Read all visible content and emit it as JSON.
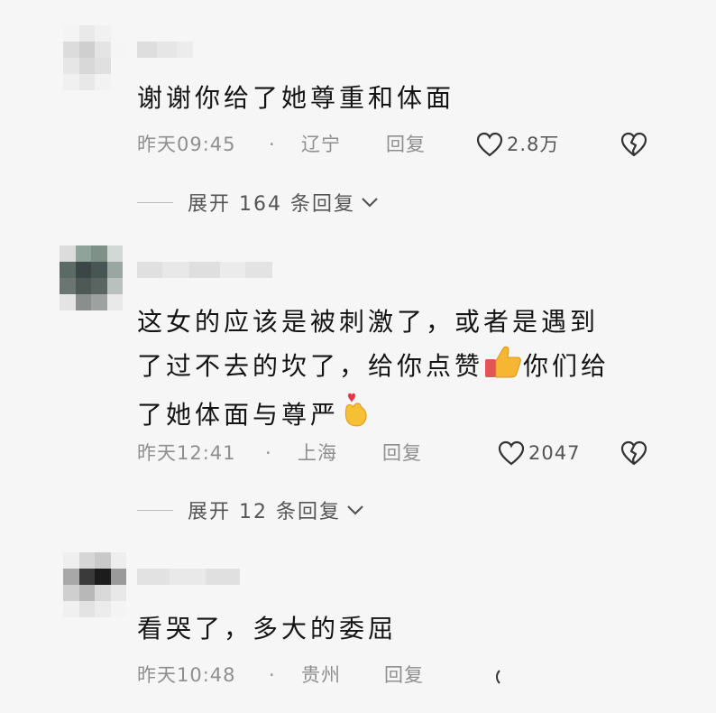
{
  "comments": [
    {
      "text_lines": [
        "谢谢你给了她尊重和体面"
      ],
      "time": "昨天09:45",
      "separator": "·",
      "location": "辽宁",
      "reply_label": "回复",
      "likes": "2.8万",
      "expand_label": "展开 164 条回复"
    },
    {
      "text_lines": [
        "这女的应该是被刺激了，或者是遇到",
        "了过不去的坎了，给你点赞",
        "你们给",
        "了她体面与尊严"
      ],
      "time": "昨天12:41",
      "separator": "·",
      "location": "上海",
      "reply_label": "回复",
      "likes": "2047",
      "expand_label": "展开 12 条回复"
    },
    {
      "text_lines": [
        "看哭了，多大的委屈"
      ],
      "time": "昨天10:48",
      "separator": "·",
      "location": "贵州",
      "reply_label": "回复"
    }
  ],
  "icons": {
    "like": "heart-outline-icon",
    "dislike": "broken-heart-icon",
    "expand": "chevron-down-icon",
    "thumbs_up": "thumbs-up-emoji",
    "finger_heart": "finger-heart-emoji"
  },
  "colors": {
    "background": "#f6f6f6",
    "text": "#141414",
    "meta": "#8f8f8f",
    "icon": "#333333"
  }
}
